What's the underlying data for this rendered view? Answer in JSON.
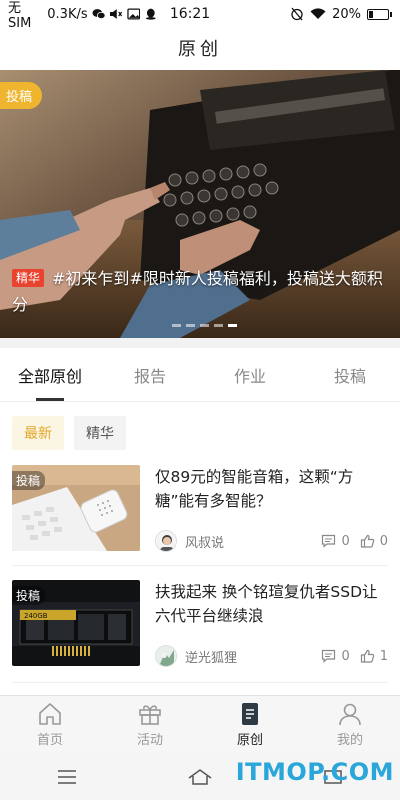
{
  "status_bar": {
    "carrier": "无SIM",
    "speed": "0.3K/s",
    "time": "16:21",
    "battery": "20%",
    "battery_level": 0.2
  },
  "header": {
    "title": "原创"
  },
  "banner": {
    "tag": "投稿",
    "essence_badge": "精华",
    "caption": "#初来乍到#限时新人投稿福利，投稿送大额积分",
    "slide_count": 5,
    "active_slide": 5
  },
  "tabs": [
    {
      "label": "全部原创",
      "active": true
    },
    {
      "label": "报告",
      "active": false
    },
    {
      "label": "作业",
      "active": false
    },
    {
      "label": "投稿",
      "active": false
    }
  ],
  "filters": [
    {
      "label": "最新",
      "active": true
    },
    {
      "label": "精华",
      "active": false
    }
  ],
  "articles": [
    {
      "tag": "投稿",
      "title": "仅89元的智能音箱，这颗“方糖”能有多智能？",
      "author": "风叔说",
      "comments": "0",
      "likes": "0",
      "thumb_icon": "smart-speaker-image"
    },
    {
      "tag": "投稿",
      "title": "扶我起来 换个铭瑄复仇者SSD让六代平台继续浪",
      "author": "逆光狐狸",
      "comments": "0",
      "likes": "1",
      "thumb_icon": "ssd-card-image",
      "thumb_text": "240GB"
    }
  ],
  "bottom_nav": [
    {
      "label": "首页",
      "icon": "home-icon",
      "active": false
    },
    {
      "label": "活动",
      "icon": "gift-icon",
      "active": false
    },
    {
      "label": "原创",
      "icon": "document-icon",
      "active": true
    },
    {
      "label": "我的",
      "icon": "person-icon",
      "active": false
    }
  ],
  "watermark": "ITMOP.COM",
  "colors": {
    "accent": "#e2a727",
    "tag_yellow": "#f0b52f",
    "essence_red": "#e9432f",
    "watermark_blue": "#2aa6da"
  }
}
